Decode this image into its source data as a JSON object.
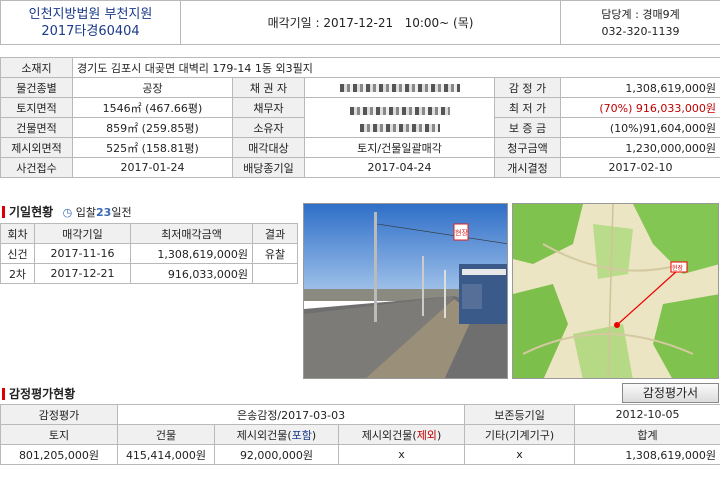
{
  "header": {
    "court_name": "인천지방법원 부천지원",
    "case_number": "2017타경60404",
    "sale_date": "매각기일 : 2017-12-21   10:00~ (목)",
    "dept": "담당계 : 경매9계",
    "phone": "032-320-1139"
  },
  "property": {
    "address_label": "소재지",
    "address": "경기도 김포시 대곶면 대벽리 179-14 1동 외3필지",
    "rows": [
      {
        "l1": "물건종별",
        "v1": "공장",
        "l2": "채 권 자",
        "v2": "",
        "l3": "감 정 가",
        "v3": "1,308,619,000원"
      },
      {
        "l1": "토지면적",
        "v1": "1546㎡ (467.66평)",
        "l2": "채무자",
        "v2": "",
        "l3": "최 저 가",
        "v3": "(70%) 916,033,000원"
      },
      {
        "l1": "건물면적",
        "v1": "859㎡ (259.85평)",
        "l2": "소유자",
        "v2": "",
        "l3": "보 증 금",
        "v3": "(10%)91,604,000원"
      },
      {
        "l1": "제시외면적",
        "v1": "525㎡ (158.81평)",
        "l2": "매각대상",
        "v2": "토지/건물일괄매각",
        "l3": "청구금액",
        "v3": "1,230,000,000원"
      },
      {
        "l1": "사건접수",
        "v1": "2017-01-24",
        "l2": "배당종기일",
        "v2": "2017-04-24",
        "l3": "개시결정",
        "v3": "2017-02-10"
      }
    ]
  },
  "history": {
    "title": "기일현황",
    "badge": "입찰23일전",
    "headers": [
      "회차",
      "매각기일",
      "최저매각금액",
      "결과"
    ],
    "rows": [
      {
        "round": "신건",
        "date": "2017-11-16",
        "price": "1,308,619,000원",
        "result": "유찰"
      },
      {
        "round": "2차",
        "date": "2017-12-21",
        "price": "916,033,000원",
        "result": ""
      }
    ]
  },
  "appraisal": {
    "title": "감정평가현황",
    "button": "감정평가서",
    "r1": {
      "label": "감정평가",
      "value": "은송감정/2017-03-03",
      "label2": "보존등기일",
      "value2": "2012-10-05"
    },
    "headers": {
      "h1": "토지",
      "h2": "건물",
      "h3a": "제시외건물(",
      "h3b": "포함",
      "h3c": ")",
      "h4a": "제시외건물(",
      "h4b": "제외",
      "h4c": ")",
      "h5": "기타(기계기구)",
      "h6": "합계"
    },
    "values": [
      "801,205,000원",
      "415,414,000원",
      "92,000,000원",
      "x",
      "x",
      "1,308,619,000원"
    ]
  },
  "photo": {
    "sign": "현장"
  },
  "map": {
    "marker": "현장"
  }
}
